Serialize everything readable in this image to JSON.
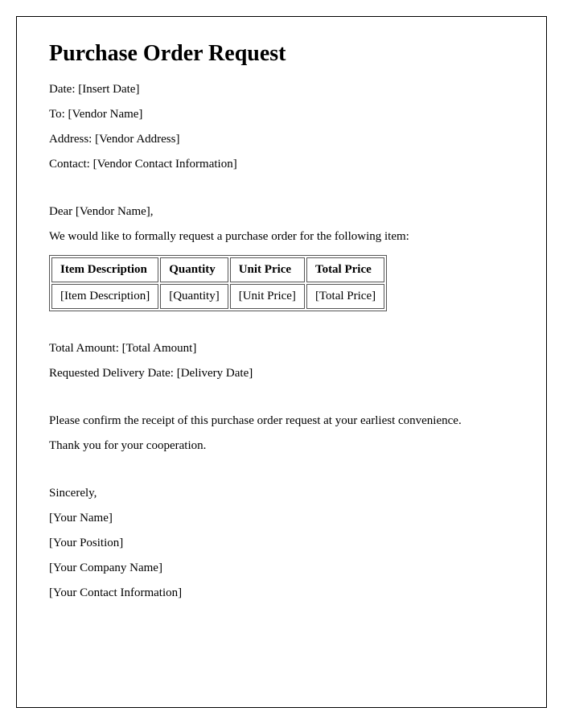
{
  "title": "Purchase Order Request",
  "header": {
    "date_label": "Date:",
    "date_value": "[Insert Date]",
    "to_label": "To:",
    "to_value": "[Vendor Name]",
    "address_label": "Address:",
    "address_value": "[Vendor Address]",
    "contact_label": "Contact:",
    "contact_value": "[Vendor Contact Information]"
  },
  "salutation": "Dear [Vendor Name],",
  "intro": "We would like to formally request a purchase order for the following item:",
  "table": {
    "headers": {
      "item": "Item Description",
      "qty": "Quantity",
      "unit": "Unit Price",
      "total": "Total Price"
    },
    "row": {
      "item": "[Item Description]",
      "qty": "[Quantity]",
      "unit": "[Unit Price]",
      "total": "[Total Price]"
    }
  },
  "totals": {
    "amount_label": "Total Amount:",
    "amount_value": "[Total Amount]",
    "delivery_label": "Requested Delivery Date:",
    "delivery_value": "[Delivery Date]"
  },
  "closing": {
    "confirm": "Please confirm the receipt of this purchase order request at your earliest convenience.",
    "thanks": "Thank you for your cooperation."
  },
  "signature": {
    "sincerely": "Sincerely,",
    "name": "[Your Name]",
    "position": "[Your Position]",
    "company": "[Your Company Name]",
    "contact": "[Your Contact Information]"
  }
}
